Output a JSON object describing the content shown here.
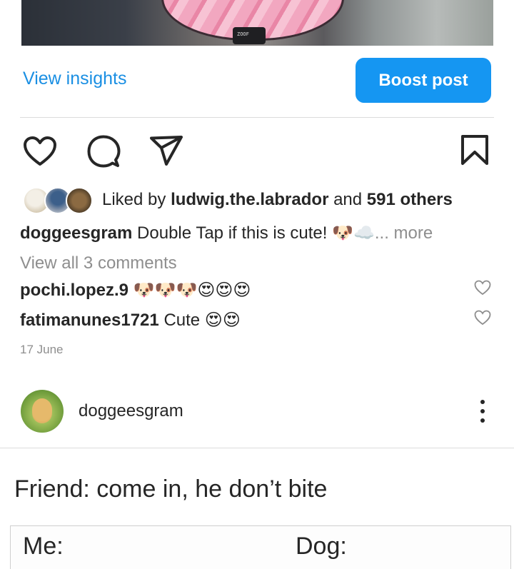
{
  "post": {
    "view_insights_label": "View insights",
    "boost_label": "Boost post",
    "liked_by_prefix": "Liked by",
    "liked_by_user": "ludwig.the.labrador",
    "liked_by_and": "and",
    "liked_by_others": "591 others",
    "caption_user": "doggeesgram",
    "caption_text": "Double Tap if this is cute! 🐶☁️",
    "caption_more": "... more",
    "view_all_comments": "View all 3 comments",
    "comments": [
      {
        "user": "pochi.lopez.9",
        "text": "🐶🐶🐶😍😍😍"
      },
      {
        "user": "fatimanunes1721",
        "text": "Cute 😍😍"
      }
    ],
    "date": "17 June",
    "photo_tag_text": "ZOOF"
  },
  "next_post": {
    "username": "doggeesgram",
    "meme_caption": "Friend: come in, he don’t bite",
    "meme_left_label": "Me:",
    "meme_right_label": "Dog:"
  },
  "colors": {
    "link_blue": "#1a8fe3",
    "button_blue": "#1596f2",
    "muted_text": "#8e8e8e"
  },
  "icons": [
    "heart-icon",
    "comment-icon",
    "share-icon",
    "bookmark-icon",
    "small-heart-icon",
    "more-vertical-icon"
  ]
}
